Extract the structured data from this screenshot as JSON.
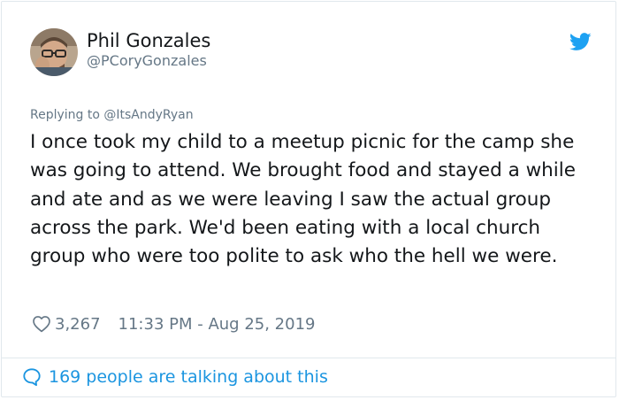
{
  "author": {
    "display_name": "Phil Gonzales",
    "handle": "@PCoryGonzales"
  },
  "reply": {
    "prefix": "Replying to ",
    "mention": "@ItsAndyRyan"
  },
  "tweet": {
    "text": "I once took my child to a meetup picnic for the camp she was going to attend. We brought food and stayed a while and ate and as we were leaving I saw the actual group across the park. We'd been eating with a local church group who were too polite to ask who the hell we were."
  },
  "stats": {
    "likes": "3,267",
    "timestamp": "11:33 PM - Aug 25, 2019"
  },
  "footer": {
    "talking": "169 people are talking about this"
  },
  "icons": {
    "brand": "twitter-bird-icon",
    "like": "heart-icon",
    "reply": "speech-bubble-icon"
  },
  "colors": {
    "brand_blue": "#1da1f2",
    "link_blue": "#1b95e0",
    "secondary_text": "#657786",
    "primary_text": "#14171a",
    "border": "#e1e8ed"
  }
}
